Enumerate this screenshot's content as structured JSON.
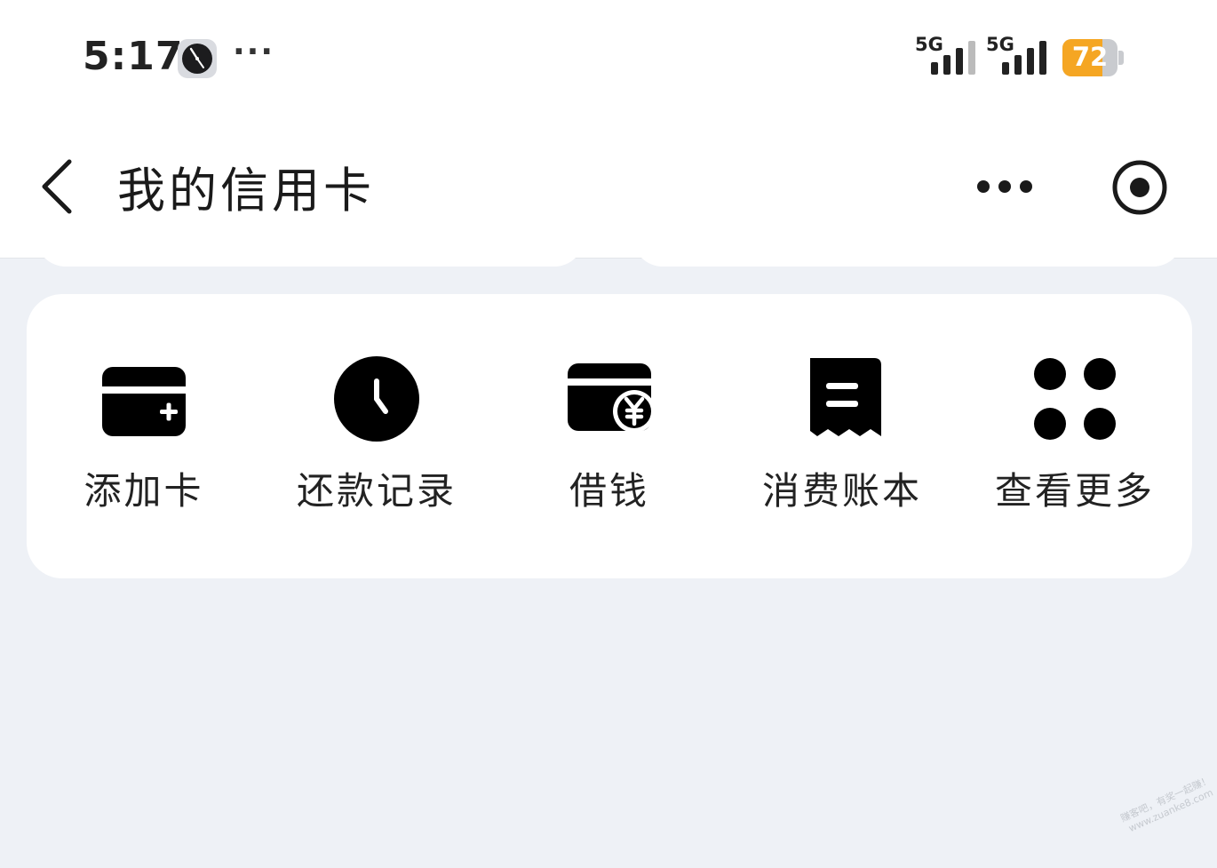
{
  "status_bar": {
    "time": "5:17",
    "overflow": "···",
    "signal_1_label": "5G",
    "signal_2_label": "5G",
    "battery": "72",
    "battery_level": 0.72,
    "battery_color": "#f5a623"
  },
  "nav": {
    "title": "我的信用卡",
    "back_icon": "chevron-left-icon",
    "more_icon": "more-dots-icon",
    "close_icon": "target-icon"
  },
  "actions": [
    {
      "label": "添加卡",
      "icon": "add-card-icon"
    },
    {
      "label": "还款记录",
      "icon": "clock-icon"
    },
    {
      "label": "借钱",
      "icon": "card-yen-icon"
    },
    {
      "label": "消费账本",
      "icon": "receipt-icon"
    },
    {
      "label": "查看更多",
      "icon": "grid-dots-icon"
    }
  ],
  "watermark": {
    "line1": "赚客吧，有奖一起赚！",
    "line2": "www.zuanke8.com"
  },
  "colors": {
    "background": "#eef1f6",
    "surface": "#ffffff",
    "text": "#222222"
  }
}
